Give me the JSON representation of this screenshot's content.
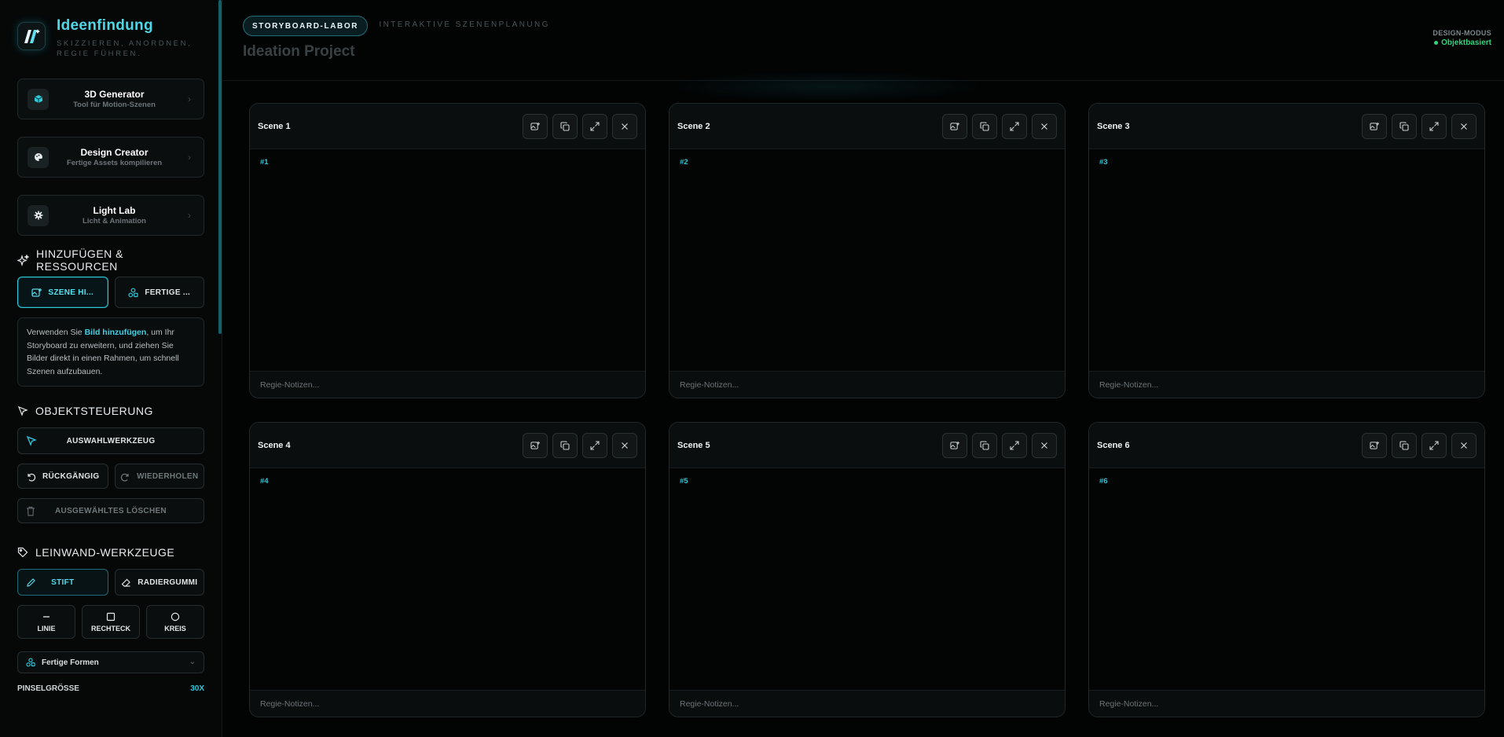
{
  "brand": {
    "title": "Ideenfindung",
    "subtitle": "SKIZZIEREN, ANORDNEN, REGIE FÜHREN."
  },
  "tools": [
    {
      "title": "3D Generator",
      "subtitle": "Tool für Motion-Szenen",
      "icon": "cube-icon"
    },
    {
      "title": "Design Creator",
      "subtitle": "Fertige Assets kompilieren",
      "icon": "palette-icon"
    },
    {
      "title": "Light Lab",
      "subtitle": "Licht & Animation",
      "icon": "gear-icon"
    }
  ],
  "resources": {
    "heading": "HINZUFÜGEN & RESSOURCEN",
    "add_scene_label": "SZENE HI...",
    "ready_label": "FERTIGE ...",
    "info_prefix": "Verwenden Sie ",
    "info_highlight": "Bild hinzufügen",
    "info_suffix": ", um Ihr Storyboard zu erweitern, und ziehen Sie Bilder direkt in einen Rahmen, um schnell Szenen aufzubauen."
  },
  "object_control": {
    "heading": "OBJEKTSTEUERUNG",
    "select_tool": "AUSWAHLWERKZEUG",
    "undo": "RÜCKGÄNGIG",
    "redo": "WIEDERHOLEN",
    "delete_selected": "AUSGEWÄHLTES LÖSCHEN"
  },
  "canvas_tools": {
    "heading": "LEINWAND-WERKZEUGE",
    "pen": "STIFT",
    "eraser": "RADIERGUMMI",
    "line": "LINIE",
    "rect": "RECHTECK",
    "circle": "KREIS",
    "shapes_select": "Fertige Formen",
    "brush_size_label": "PINSELGRÖSSE",
    "brush_size_value": "30X"
  },
  "header": {
    "pill": "STORYBOARD-LABOR",
    "subtitle": "INTERAKTIVE SZENENPLANUNG",
    "project": "Ideation Project",
    "mode_label": "DESIGN-MODUS",
    "mode_value": "Objektbasiert"
  },
  "colors": {
    "accent": "#2ec8da",
    "status_green": "#2fd37c"
  },
  "scenes": [
    {
      "title": "Scene 1",
      "num": "#1",
      "notes_placeholder": "Regie-Notizen..."
    },
    {
      "title": "Scene 2",
      "num": "#2",
      "notes_placeholder": "Regie-Notizen..."
    },
    {
      "title": "Scene 3",
      "num": "#3",
      "notes_placeholder": "Regie-Notizen..."
    },
    {
      "title": "Scene 4",
      "num": "#4",
      "notes_placeholder": "Regie-Notizen..."
    },
    {
      "title": "Scene 5",
      "num": "#5",
      "notes_placeholder": "Regie-Notizen..."
    },
    {
      "title": "Scene 6",
      "num": "#6",
      "notes_placeholder": "Regie-Notizen..."
    }
  ]
}
